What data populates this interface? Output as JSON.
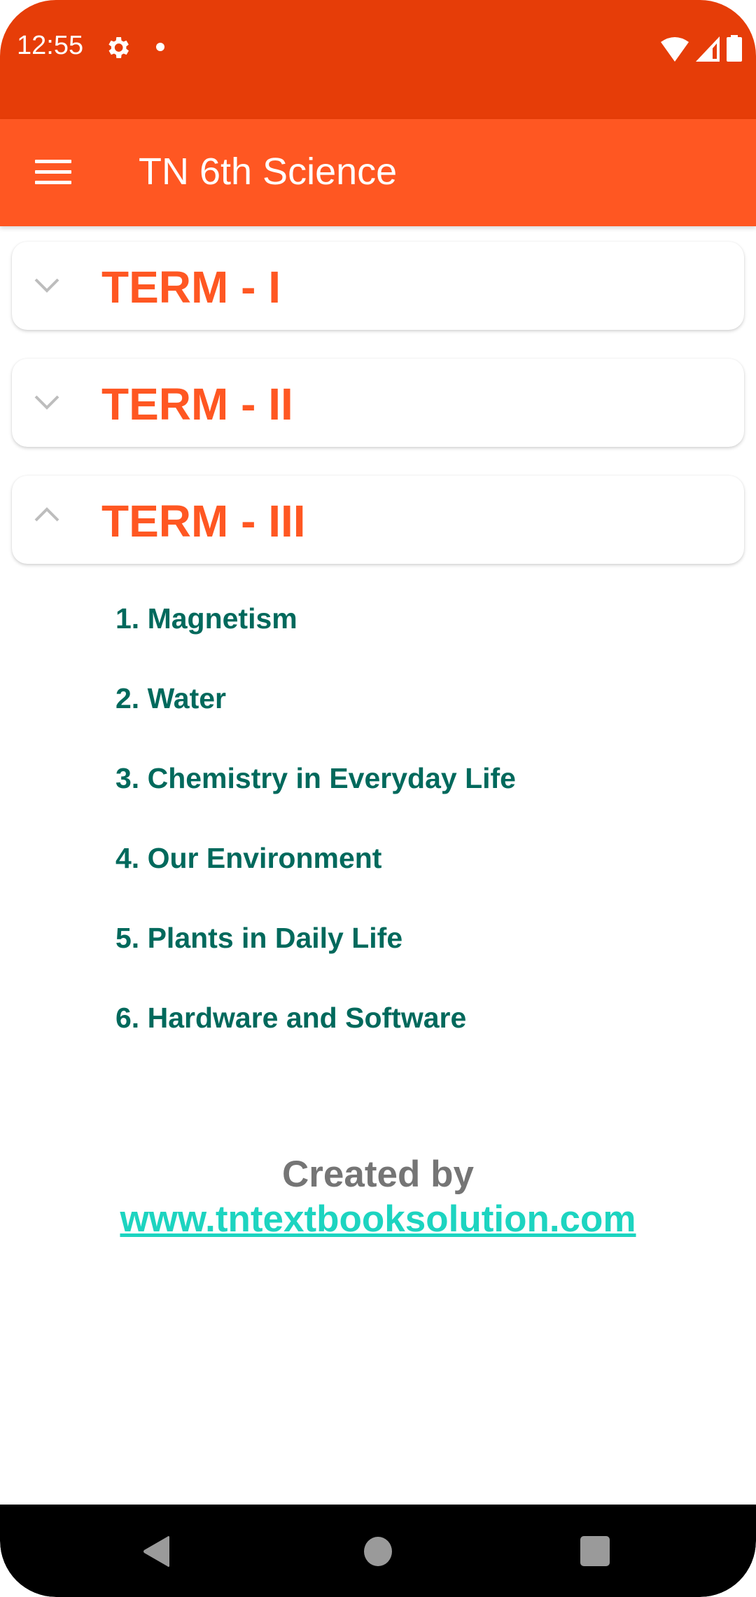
{
  "status_bar": {
    "time": "12:55",
    "icons": [
      "gear-icon",
      "notification-dot-icon",
      "wifi-icon",
      "signal-icon",
      "battery-icon"
    ]
  },
  "app_bar": {
    "title": "TN 6th Science",
    "menu_icon": "hamburger-menu-icon"
  },
  "terms": [
    {
      "label": "TERM - I",
      "expanded": false,
      "icon": "chevron-down-icon"
    },
    {
      "label": "TERM - II",
      "expanded": false,
      "icon": "chevron-down-icon"
    },
    {
      "label": "TERM - III",
      "expanded": true,
      "icon": "chevron-up-icon"
    }
  ],
  "chapters": [
    "1. Magnetism",
    "2. Water",
    "3. Chemistry in Everyday Life",
    "4. Our Environment",
    "5. Plants in Daily Life",
    "6. Hardware and Software"
  ],
  "footer": {
    "created_by": "Created by",
    "link": "www.tntextbooksolution.com"
  },
  "nav_bar": {
    "buttons": [
      "back-icon",
      "home-icon",
      "recents-icon"
    ]
  },
  "colors": {
    "status_bar": "#E63D08",
    "app_bar": "#FF5722",
    "term_text": "#FF5722",
    "chapter_text": "#00695C",
    "credit_text": "#757575",
    "link_text": "#1DD4C0"
  }
}
